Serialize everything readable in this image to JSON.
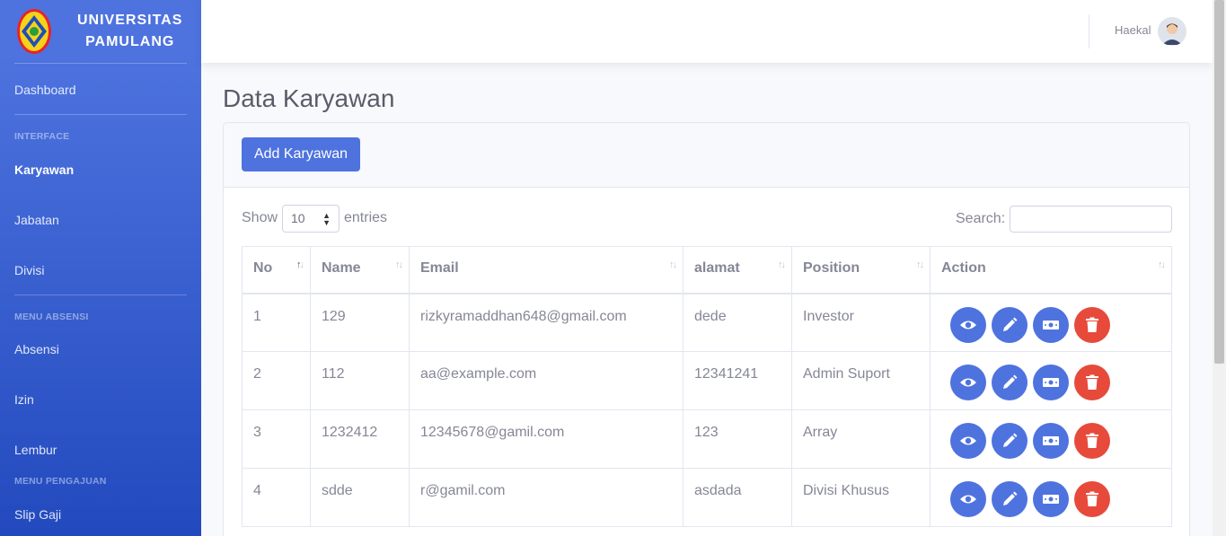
{
  "brand": {
    "line1": "UNIVERSITAS",
    "line2": "PAMULANG"
  },
  "sidebar": {
    "dashboard": "Dashboard",
    "heading_interface": "INTERFACE",
    "karyawan": "Karyawan",
    "jabatan": "Jabatan",
    "divisi": "Divisi",
    "heading_absensi": "MENU ABSENSI",
    "absensi": "Absensi",
    "izin": "Izin",
    "lembur": "Lembur",
    "heading_pengajuan": "MENU PENGAJUAN",
    "slip_gaji": "Slip Gaji"
  },
  "topbar": {
    "username": "Haekal",
    "avatar_icon": "user-avatar-icon"
  },
  "page": {
    "title": "Data Karyawan",
    "add_button": "Add Karyawan"
  },
  "table_controls": {
    "show": "Show",
    "entries_value": "10",
    "entries": "entries",
    "search": "Search:",
    "search_value": ""
  },
  "table": {
    "headers": [
      "No",
      "Name",
      "Email",
      "alamat",
      "Position",
      "Action"
    ],
    "rows": [
      {
        "no": "1",
        "name": "129",
        "email": "rizkyramaddhan648@gmail.com",
        "alamat": "dede",
        "position": "Investor"
      },
      {
        "no": "2",
        "name": "112",
        "email": "aa@example.com",
        "alamat": "12341241",
        "position": "Admin Suport"
      },
      {
        "no": "3",
        "name": "1232412",
        "email": "12345678@gamil.com",
        "alamat": "123",
        "position": "Array"
      },
      {
        "no": "4",
        "name": "sdde",
        "email": "r@gamil.com",
        "alamat": "asdada",
        "position": "Divisi Khusus"
      }
    ]
  },
  "colors": {
    "primary": "#4e73df",
    "danger": "#e74a3b",
    "sidebar_end": "#224abe"
  }
}
